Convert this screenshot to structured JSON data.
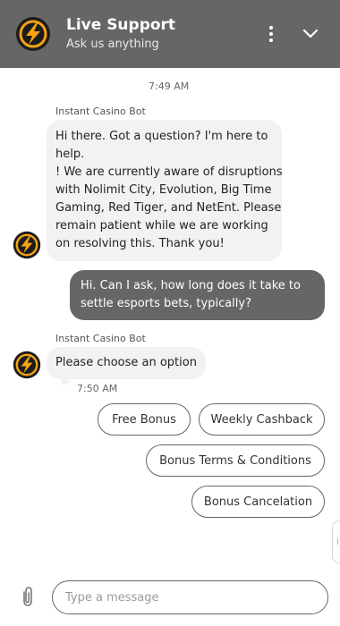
{
  "header": {
    "title": "Live Support",
    "subtitle": "Ask us anything",
    "background": "#666666"
  },
  "icons": {
    "avatar": "lightning-bolt-logo-icon",
    "menu": "kebab-menu-icon",
    "collapse": "chevron-down-icon",
    "attach": "paperclip-icon"
  },
  "colors": {
    "brand_orange": "#f5a313",
    "brand_dark": "#1c1c1c",
    "bot_bubble": "#f1f2f4",
    "user_bubble": "#666666"
  },
  "chat": {
    "time_1": "7:49 AM",
    "bot_name_1": "Instant Casino Bot",
    "bot_message_1": [
      "Hi there. Got a question? I'm here to",
      "help.",
      "! We are currently aware of disruptions",
      "with Nolimit City, Evolution, Big Time",
      "Gaming, Red Tiger, and NetEnt. Please",
      "remain patient while we are working",
      "on resolving this. Thank you!"
    ],
    "user_message": [
      "Hi. Can I ask, how long does it take to",
      "settle esports bets, typically?"
    ],
    "bot_name_2": "Instant Casino Bot",
    "bot_message_2": "Please choose an option",
    "time_2": "7:50 AM"
  },
  "options": [
    "Free Bonus",
    "Weekly Cashback",
    "Bonus Terms & Conditions",
    "Bonus Cancelation"
  ],
  "composer": {
    "placeholder": "Type a message"
  }
}
